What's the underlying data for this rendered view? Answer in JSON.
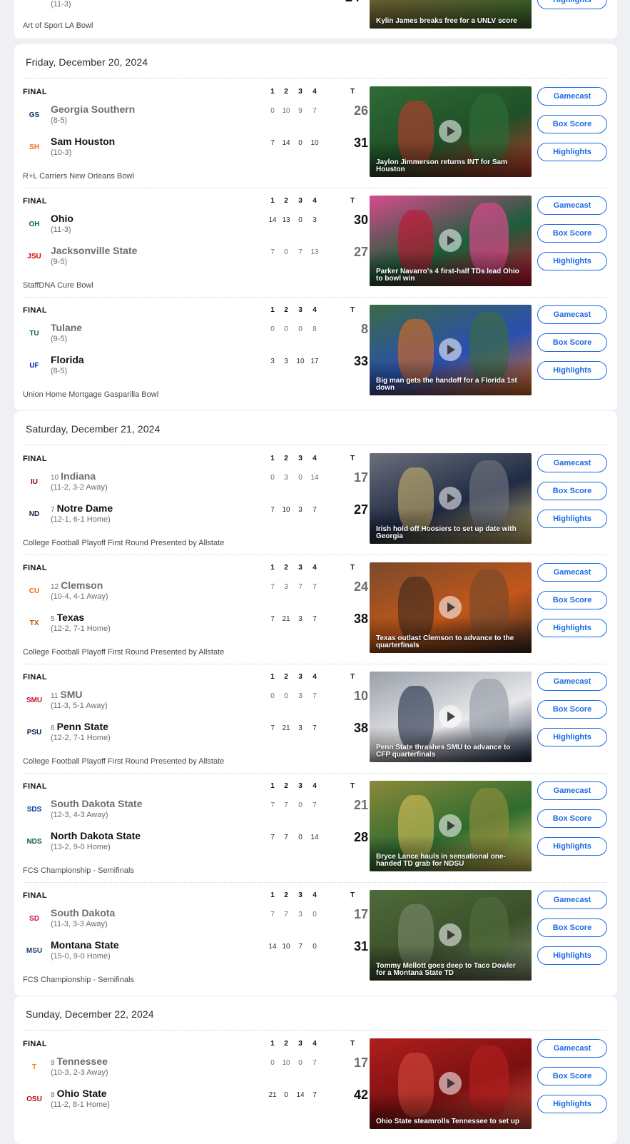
{
  "quarters": [
    "1",
    "2",
    "3",
    "4"
  ],
  "total_label": "T",
  "status_label": "FINAL",
  "buttons": {
    "gamecast": "Gamecast",
    "boxscore": "Box Score",
    "highlights": "Highlights"
  },
  "top": {
    "record": "(11-3)",
    "note": "Art of Sport LA Bowl",
    "caption": "Kylin James breaks free for a UNLV score",
    "highlights": "Highlights"
  },
  "days": [
    {
      "title": "Friday, December 20, 2024",
      "games": [
        {
          "note": "R+L Carriers New Orleans Bowl",
          "caption": "Jaylon Jimmerson returns INT for Sam Houston",
          "colors": [
            "#2f6b36",
            "#1f4f27",
            "#c0392b"
          ],
          "teams": [
            {
              "name": "Georgia Southern",
              "rank": "",
              "record": "(8-5)",
              "q": [
                "0",
                "10",
                "9",
                "7"
              ],
              "t": "26",
              "win": false,
              "logo": "GS",
              "logo_color": "#0a3161"
            },
            {
              "name": "Sam Houston",
              "rank": "",
              "record": "(10-3)",
              "q": [
                "7",
                "14",
                "0",
                "10"
              ],
              "t": "31",
              "win": true,
              "logo": "SH",
              "logo_color": "#f26b21"
            }
          ]
        },
        {
          "note": "StaffDNA Cure Bowl",
          "caption": "Parker Navarro's 4 first-half TDs lead Ohio to bowl win",
          "colors": [
            "#d94a8c",
            "#1b5e3b",
            "#c8102e"
          ],
          "teams": [
            {
              "name": "Ohio",
              "rank": "",
              "record": "(11-3)",
              "q": [
                "14",
                "13",
                "0",
                "3"
              ],
              "t": "30",
              "win": true,
              "logo": "OH",
              "logo_color": "#00694e"
            },
            {
              "name": "Jacksonville State",
              "rank": "",
              "record": "(9-5)",
              "q": [
                "7",
                "0",
                "7",
                "13"
              ],
              "t": "27",
              "win": false,
              "logo": "JSU",
              "logo_color": "#cc0000"
            }
          ]
        },
        {
          "note": "Union Home Mortgage Gasparilla Bowl",
          "caption": "Big man gets the handoff for a Florida 1st down",
          "colors": [
            "#3a6b45",
            "#2a4fb0",
            "#e06a1a"
          ],
          "teams": [
            {
              "name": "Tulane",
              "rank": "",
              "record": "(9-5)",
              "q": [
                "0",
                "0",
                "0",
                "8"
              ],
              "t": "8",
              "win": false,
              "logo": "TU",
              "logo_color": "#006747"
            },
            {
              "name": "Florida",
              "rank": "",
              "record": "(8-5)",
              "q": [
                "3",
                "3",
                "10",
                "17"
              ],
              "t": "33",
              "win": true,
              "logo": "UF",
              "logo_color": "#0021a5"
            }
          ]
        }
      ]
    },
    {
      "title": "Saturday, December 21, 2024",
      "games": [
        {
          "note": "College Football Playoff First Round Presented by Allstate",
          "caption": "Irish hold off Hoosiers to set up date with Georgia",
          "colors": [
            "#6b6f7a",
            "#1f2a44",
            "#c9b36a"
          ],
          "teams": [
            {
              "name": "Indiana",
              "rank": "10",
              "record": "(11-2, 3-2 Away)",
              "q": [
                "0",
                "3",
                "0",
                "14"
              ],
              "t": "17",
              "win": false,
              "logo": "IU",
              "logo_color": "#990000"
            },
            {
              "name": "Notre Dame",
              "rank": "7",
              "record": "(12-1, 6-1 Home)",
              "q": [
                "7",
                "10",
                "3",
                "7"
              ],
              "t": "27",
              "win": true,
              "logo": "ND",
              "logo_color": "#0c2340"
            }
          ]
        },
        {
          "note": "College Football Playoff First Round Presented by Allstate",
          "caption": "Texas outlast Clemson to advance to the quarterfinals",
          "colors": [
            "#7a4a2a",
            "#c2571a",
            "#3b2a20"
          ],
          "teams": [
            {
              "name": "Clemson",
              "rank": "12",
              "record": "(10-4, 4-1 Away)",
              "q": [
                "7",
                "3",
                "7",
                "7"
              ],
              "t": "24",
              "win": false,
              "logo": "CU",
              "logo_color": "#f56600"
            },
            {
              "name": "Texas",
              "rank": "5",
              "record": "(12-2, 7-1 Home)",
              "q": [
                "7",
                "21",
                "3",
                "7"
              ],
              "t": "38",
              "win": true,
              "logo": "TX",
              "logo_color": "#bf5700"
            }
          ]
        },
        {
          "note": "College Football Playoff First Round Presented by Allstate",
          "caption": "Penn State thrashes SMU to advance to CFP quarterfinals",
          "colors": [
            "#9aa0aa",
            "#e8e8ea",
            "#1e2a44"
          ],
          "teams": [
            {
              "name": "SMU",
              "rank": "11",
              "record": "(11-3, 5-1 Away)",
              "q": [
                "0",
                "0",
                "3",
                "7"
              ],
              "t": "10",
              "win": false,
              "logo": "SMU",
              "logo_color": "#c8102e"
            },
            {
              "name": "Penn State",
              "rank": "6",
              "record": "(12-2, 7-1 Home)",
              "q": [
                "7",
                "21",
                "3",
                "7"
              ],
              "t": "38",
              "win": true,
              "logo": "PSU",
              "logo_color": "#041e42"
            }
          ]
        },
        {
          "note": "FCS Championship - Semifinals",
          "caption": "Bryce Lance hauls in sensational one-handed TD grab for NDSU",
          "colors": [
            "#8a8a3a",
            "#2f6b2f",
            "#d8c25a"
          ],
          "teams": [
            {
              "name": "South Dakota State",
              "rank": "",
              "record": "(12-3, 4-3 Away)",
              "q": [
                "7",
                "7",
                "0",
                "7"
              ],
              "t": "21",
              "win": false,
              "logo": "SDS",
              "logo_color": "#0033a0"
            },
            {
              "name": "North Dakota State",
              "rank": "",
              "record": "(13-2, 9-0 Home)",
              "q": [
                "7",
                "7",
                "0",
                "14"
              ],
              "t": "28",
              "win": true,
              "logo": "NDS",
              "logo_color": "#0a5640"
            }
          ]
        },
        {
          "note": "FCS Championship - Semifinals",
          "caption": "Tommy Mellott goes deep to Taco Dowler for a Montana State TD",
          "colors": [
            "#4f6b3a",
            "#3a4f2a",
            "#7c8a6a"
          ],
          "teams": [
            {
              "name": "South Dakota",
              "rank": "",
              "record": "(11-3, 3-3 Away)",
              "q": [
                "7",
                "7",
                "3",
                "0"
              ],
              "t": "17",
              "win": false,
              "logo": "SD",
              "logo_color": "#cd1241"
            },
            {
              "name": "Montana State",
              "rank": "",
              "record": "(15-0, 9-0 Home)",
              "q": [
                "14",
                "10",
                "7",
                "0"
              ],
              "t": "31",
              "win": true,
              "logo": "MSU",
              "logo_color": "#1e3a6e"
            }
          ]
        }
      ]
    },
    {
      "title": "Sunday, December 22, 2024",
      "games": [
        {
          "note": "",
          "caption": "Ohio State steamrolls Tennessee to set up",
          "colors": [
            "#b01e1e",
            "#7a1010",
            "#d44a3a"
          ],
          "teams": [
            {
              "name": "Tennessee",
              "rank": "9",
              "record": "(10-3, 2-3 Away)",
              "q": [
                "0",
                "10",
                "0",
                "7"
              ],
              "t": "17",
              "win": false,
              "logo": "T",
              "logo_color": "#ff8200"
            },
            {
              "name": "Ohio State",
              "rank": "8",
              "record": "(11-2, 8-1 Home)",
              "q": [
                "21",
                "0",
                "14",
                "7"
              ],
              "t": "42",
              "win": true,
              "logo": "OSU",
              "logo_color": "#bb0000"
            }
          ]
        }
      ]
    }
  ]
}
